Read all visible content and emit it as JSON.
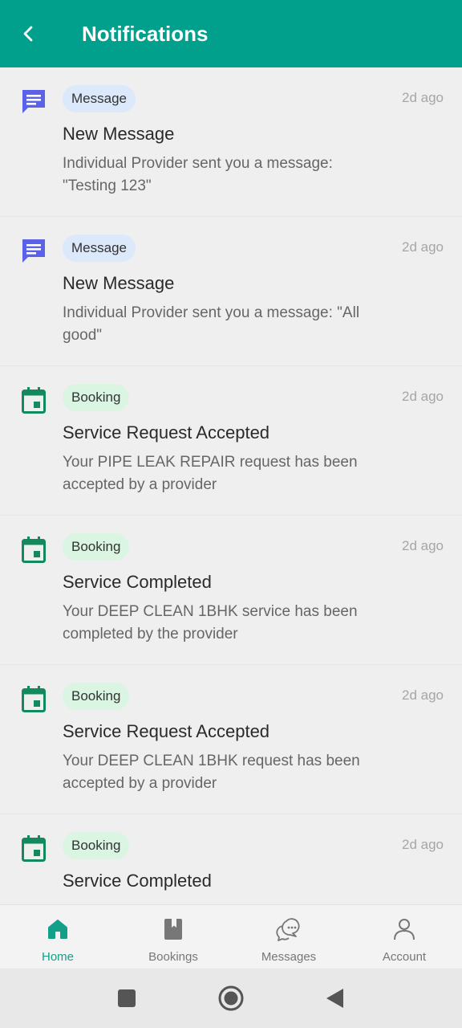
{
  "header": {
    "title": "Notifications",
    "back_icon": "chevron-left-icon",
    "background": "#00a08c"
  },
  "notifications": [
    {
      "type": "message",
      "icon": "chat-icon",
      "badge": "Message",
      "time": "2d ago",
      "title": "New Message",
      "body_line1": "Individual Provider sent you a message:",
      "body_line2": "\"Testing 123\""
    },
    {
      "type": "message",
      "icon": "chat-icon",
      "badge": "Message",
      "time": "2d ago",
      "title": "New Message",
      "body_line1": "Individual Provider sent you a message: \"All",
      "body_line2": "good\""
    },
    {
      "type": "booking",
      "icon": "calendar-icon",
      "badge": "Booking",
      "time": "2d ago",
      "title": "Service Request Accepted",
      "body_line1": "Your PIPE LEAK REPAIR request has been",
      "body_line2": "accepted by a provider"
    },
    {
      "type": "booking",
      "icon": "calendar-icon",
      "badge": "Booking",
      "time": "2d ago",
      "title": "Service Completed",
      "body_line1": "Your DEEP CLEAN 1BHK service has been",
      "body_line2": "completed by the provider"
    },
    {
      "type": "booking",
      "icon": "calendar-icon",
      "badge": "Booking",
      "time": "2d ago",
      "title": "Service Request Accepted",
      "body_line1": "Your DEEP CLEAN 1BHK request has been",
      "body_line2": "accepted by a provider"
    },
    {
      "type": "booking",
      "icon": "calendar-icon",
      "badge": "Booking",
      "time": "2d ago",
      "title": "Service Completed"
    }
  ],
  "tabbar": {
    "items": [
      {
        "label": "Home",
        "icon": "home-icon",
        "active": true
      },
      {
        "label": "Bookings",
        "icon": "bookmark-book-icon",
        "active": false
      },
      {
        "label": "Messages",
        "icon": "chat-bubbles-icon",
        "active": false
      },
      {
        "label": "Account",
        "icon": "person-icon",
        "active": false
      }
    ],
    "active_color": "#13a088"
  },
  "system_nav": {
    "recents_icon": "square-icon",
    "home_icon": "circle-icon",
    "back_icon": "triangle-back-icon"
  }
}
